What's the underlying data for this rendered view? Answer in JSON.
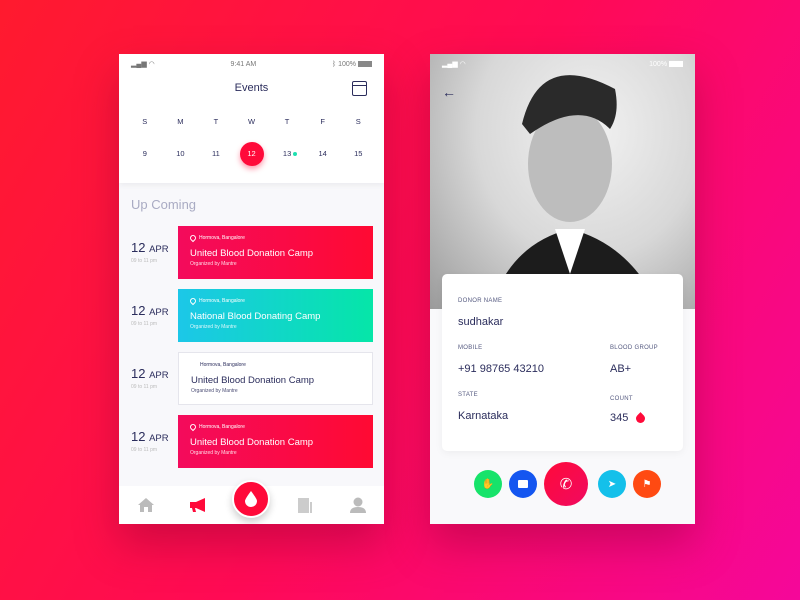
{
  "colors": {
    "accent": "#ff0a3a",
    "teal": "#1cc7e8",
    "green": "#05e6a8",
    "text": "#2b2d5c"
  },
  "events_screen": {
    "status": {
      "time": "9:41 AM",
      "battery": "100%"
    },
    "title": "Events",
    "days": [
      "S",
      "M",
      "T",
      "W",
      "T",
      "F",
      "S"
    ],
    "dates": [
      "9",
      "10",
      "11",
      "12",
      "13",
      "14",
      "15"
    ],
    "selected_date": "12",
    "section_title": "Up Coming",
    "events": [
      {
        "day": "12",
        "month": "APR",
        "time": "09 to 11 pm",
        "location": "Hormova, Bangalore",
        "name": "United Blood Donation Camp",
        "organizer": "Organized by Mantre",
        "style": "red"
      },
      {
        "day": "12",
        "month": "APR",
        "time": "09 to 11 pm",
        "location": "Hormova, Bangalore",
        "name": "National Blood Donating Camp",
        "organizer": "Organized by Mantre",
        "style": "teal"
      },
      {
        "day": "12",
        "month": "APR",
        "time": "09 to 11 pm",
        "location": "Hormova, Bangalore",
        "name": "United Blood Donation Camp",
        "organizer": "Organized by Mantre",
        "style": "white"
      },
      {
        "day": "12",
        "month": "APR",
        "time": "09 to 11 pm",
        "location": "Hormova, Bangalore",
        "name": "United Blood Donation Camp",
        "organizer": "Organized by Mantre",
        "style": "red"
      }
    ],
    "tabs": [
      "home-icon",
      "megaphone-icon",
      "blood-drop-icon",
      "document-icon",
      "user-icon"
    ]
  },
  "donor_screen": {
    "status": {
      "battery": "100%"
    },
    "donor_name_label": "DONOR NAME",
    "donor_name": "sudhakar",
    "mobile_label": "MOBILE",
    "mobile": "+91 98765 43210",
    "blood_group_label": "BLOOD GROUP",
    "blood_group": "AB+",
    "state_label": "STATE",
    "state": "Karnataka",
    "count_label": "COUNT",
    "count": "345",
    "actions": [
      "hands-icon",
      "message-icon",
      "phone-icon",
      "navigate-icon",
      "flag-icon"
    ]
  }
}
